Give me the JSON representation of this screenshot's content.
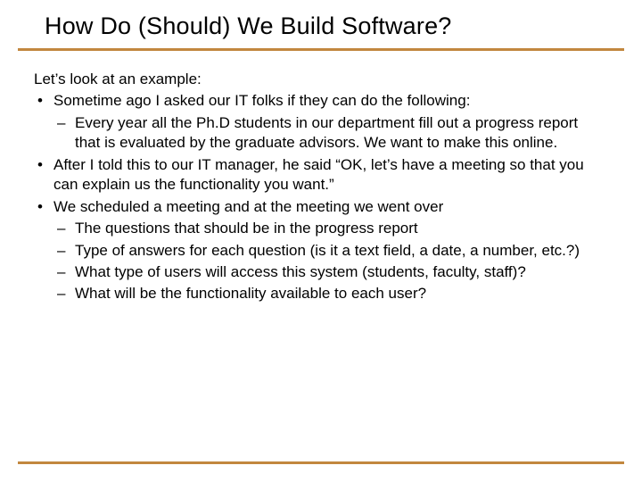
{
  "title": "How Do (Should) We Build Software?",
  "intro": "Let’s look at an example:",
  "bullets": [
    {
      "text": "Sometime ago I asked our IT folks if they can do the following:",
      "sub": [
        "Every year all the Ph.D students in our department fill out a progress report that is evaluated by the graduate advisors. We want to make this online."
      ]
    },
    {
      "text": "After I told this to our IT manager, he said “OK, let’s have a meeting so that you  can explain us the functionality you want.”",
      "sub": []
    },
    {
      "text": "We scheduled a meeting and at the meeting we went over",
      "sub": [
        "The questions that should be in the progress report",
        "Type of answers for each question (is it a text field, a date, a number, etc.?)",
        "What type of users will access this system (students, faculty, staff)?",
        "What will be the functionality available to each user?"
      ]
    }
  ],
  "colors": {
    "accent": "#c2873e"
  }
}
